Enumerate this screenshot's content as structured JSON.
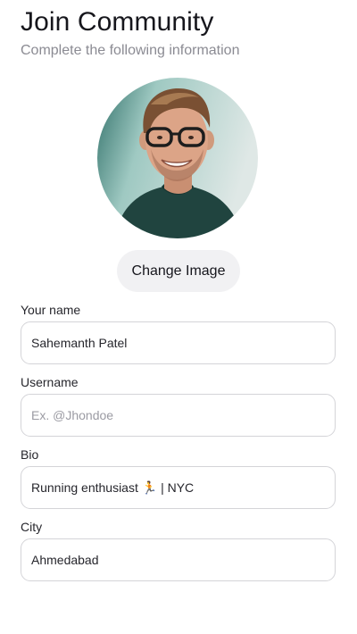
{
  "header": {
    "title": "Join Community",
    "subtitle": "Complete the following information"
  },
  "profile": {
    "avatar_icon": "profile-photo",
    "change_image_label": "Change Image"
  },
  "form": {
    "name": {
      "label": "Your name",
      "value": "Sahemanth Patel",
      "placeholder": ""
    },
    "username": {
      "label": "Username",
      "value": "",
      "placeholder": "Ex. @Jhondoe"
    },
    "bio": {
      "label": "Bio",
      "value": "Running enthusiast 🏃 | NYC",
      "placeholder": ""
    },
    "city": {
      "label": "City",
      "value": "Ahmedabad",
      "placeholder": ""
    }
  }
}
